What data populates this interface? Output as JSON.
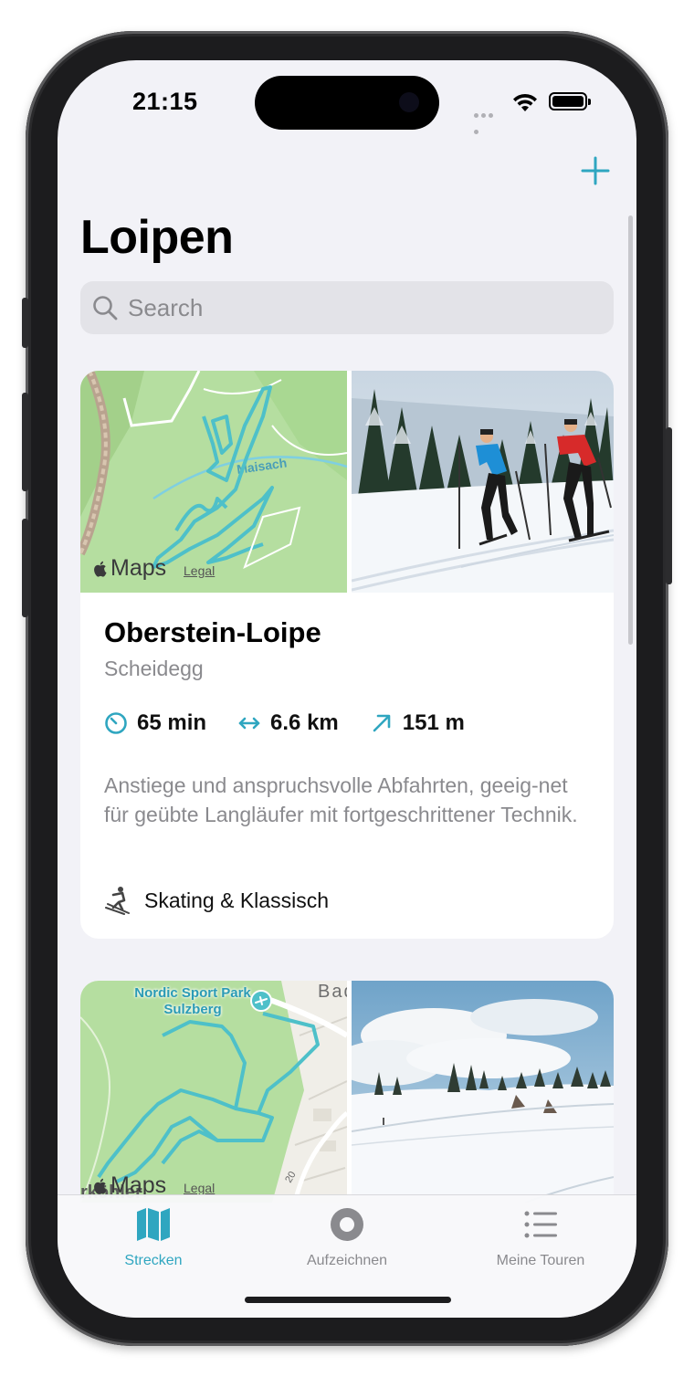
{
  "status_bar": {
    "time": "21:15"
  },
  "nav": {
    "add_icon": "plus-icon",
    "title": "Loipen"
  },
  "search": {
    "placeholder": "Search",
    "icon": "search-icon"
  },
  "cards": [
    {
      "map_brand": "Maps",
      "map_legal": "Legal",
      "map_label": "Maisach",
      "title": "Oberstein-Loipe",
      "location": "Scheidegg",
      "stats": {
        "duration": "65 min",
        "distance": "6.6 km",
        "elevation": "151 m"
      },
      "description": "Anstiege und anspruchsvolle Abfahrten, geeig-net für geübte Langläufer mit fortgeschrittener Technik.",
      "type": "Skating & Klassisch"
    },
    {
      "map_brand": "Maps",
      "map_legal": "Legal",
      "map_poi": "Nordic Sport Park Sulzberg",
      "map_label_top": "Badha",
      "map_label_bottom": "rköhler",
      "map_road": "20"
    }
  ],
  "tabbar": {
    "items": [
      {
        "label": "Strecken",
        "icon": "map-icon",
        "active": true
      },
      {
        "label": "Aufzeichnen",
        "icon": "record-icon",
        "active": false
      },
      {
        "label": "Meine Touren",
        "icon": "list-icon",
        "active": false
      }
    ]
  },
  "colors": {
    "accent": "#2fa6c0",
    "map_green": "#a8d88a",
    "trail": "#4ec0c9"
  }
}
